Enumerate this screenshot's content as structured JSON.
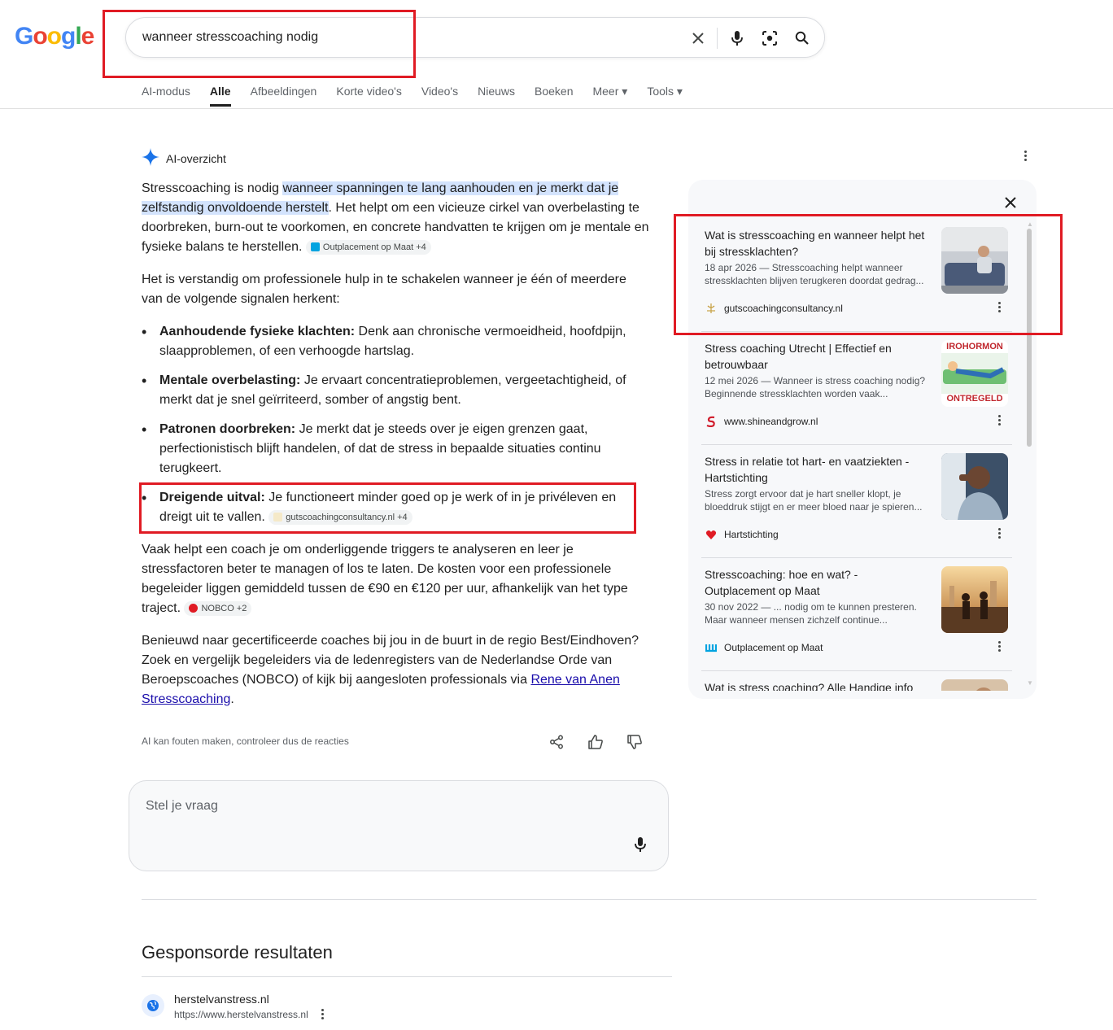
{
  "header": {
    "logo_letters": [
      "G",
      "o",
      "o",
      "g",
      "l",
      "e"
    ],
    "logo_colors": [
      "#4285F4",
      "#EA4335",
      "#FBBC05",
      "#4285F4",
      "#34A853",
      "#EA4335"
    ],
    "query": "wanneer stresscoaching nodig",
    "icons": [
      "close-icon",
      "mic-icon",
      "lens-icon",
      "search-icon"
    ]
  },
  "tabs": [
    {
      "label": "AI-modus",
      "active": false
    },
    {
      "label": "Alle",
      "active": true
    },
    {
      "label": "Afbeeldingen",
      "active": false
    },
    {
      "label": "Korte video's",
      "active": false
    },
    {
      "label": "Video's",
      "active": false
    },
    {
      "label": "Nieuws",
      "active": false
    },
    {
      "label": "Boeken",
      "active": false
    },
    {
      "label": "Meer ▾",
      "active": false
    },
    {
      "label": "Tools ▾",
      "active": false
    }
  ],
  "ai_overview": {
    "title": "AI-overzicht",
    "p1_pre": "Stresscoaching is nodig ",
    "p1_highlight": "wanneer spanningen te lang aanhouden en je merkt dat je zelfstandig onvoldoende herstelt",
    "p1_post": ". Het helpt om een vicieuze cirkel van overbelasting te doorbreken, burn-out te voorkomen, en concrete handvatten te krijgen om je mentale en fysieke balans te herstellen. ",
    "p1_chip": "Outplacement op Maat +4",
    "p2": "Het is verstandig om professionele hulp in te schakelen wanneer je één of meerdere van de volgende signalen herkent:",
    "signals": [
      {
        "bold": "Aanhoudende fysieke klachten:",
        "text": " Denk aan chronische vermoeidheid, hoofdpijn, slaapproblemen, of een verhoogde hartslag."
      },
      {
        "bold": "Mentale overbelasting:",
        "text": " Je ervaart concentratieproblemen, vergeetachtigheid, of merkt dat je snel geïrriteerd, somber of angstig bent."
      },
      {
        "bold": "Patronen doorbreken:",
        "text": " Je merkt dat je steeds over je eigen grenzen gaat, perfectionistisch blijft handelen, of dat de stress in bepaalde situaties continu terugkeert."
      },
      {
        "bold": "Dreigende uitval:",
        "text": " Je functioneert minder goed op je werk of in je privéleven en dreigt uit te vallen. ",
        "chip": "gutscoachingconsultancy.nl +4"
      }
    ],
    "p3": "Vaak helpt een coach je om onderliggende triggers te analyseren en leer je stressfactoren beter te managen of los te laten. De kosten voor een professionele begeleider liggen gemiddeld tussen de €90 en €120 per uur, afhankelijk van het type traject. ",
    "p3_chip": "NOBCO +2",
    "p4_pre": "Benieuwd naar gecertificeerde coaches bij jou in de buurt in de regio Best/Eindhoven? Zoek en vergelijk begeleiders via de ledenregisters van de Nederlandse Orde van Beroepscoaches (NOBCO) of kijk bij aangesloten professionals via ",
    "p4_link": "Rene van Anen Stresscoaching",
    "p4_post": ".",
    "disclaimer": "AI kan fouten maken, controleer dus de reacties",
    "feedback_icons": [
      "share-icon",
      "thumbs-up-icon",
      "thumbs-down-icon"
    ]
  },
  "ask": {
    "placeholder": "Stel je vraag"
  },
  "sources": [
    {
      "title": "Wat is stresscoaching en wanneer helpt het bij stressklachten?",
      "snippet": "18 apr 2026 — Stresscoaching helpt wanneer stressklachten blijven terugkeren doordat gedrag...",
      "source": "gutscoachingconsultancy.nl"
    },
    {
      "title": "Stress coaching Utrecht | Effectief en betrouwbaar",
      "snippet": "12 mei 2026 — Wanneer is stress coaching nodig? Beginnende stressklachten worden vaak...",
      "source": "www.shineandgrow.nl",
      "thumb_top": "IROHORMON",
      "thumb_bottom": "ONTREGELD"
    },
    {
      "title": "Stress in relatie tot hart- en vaatziekten - Hartstichting",
      "snippet": "Stress zorgt ervoor dat je hart sneller klopt, je bloeddruk stijgt en er meer bloed naar je spieren...",
      "source": "Hartstichting"
    },
    {
      "title": "Stresscoaching: hoe en wat? - Outplacement op Maat",
      "snippet": "30 nov 2022 — ... nodig om te kunnen presteren. Maar wanneer mensen zichzelf continue...",
      "source": "Outplacement op Maat"
    },
    {
      "title": "Wat is stress coaching? Alle Handige info",
      "snippet": "",
      "source": ""
    }
  ],
  "sponsored": {
    "heading": "Gesponsorde resultaten",
    "domain": "herstelvanstress.nl",
    "url": "https://www.herstelvanstress.nl"
  }
}
